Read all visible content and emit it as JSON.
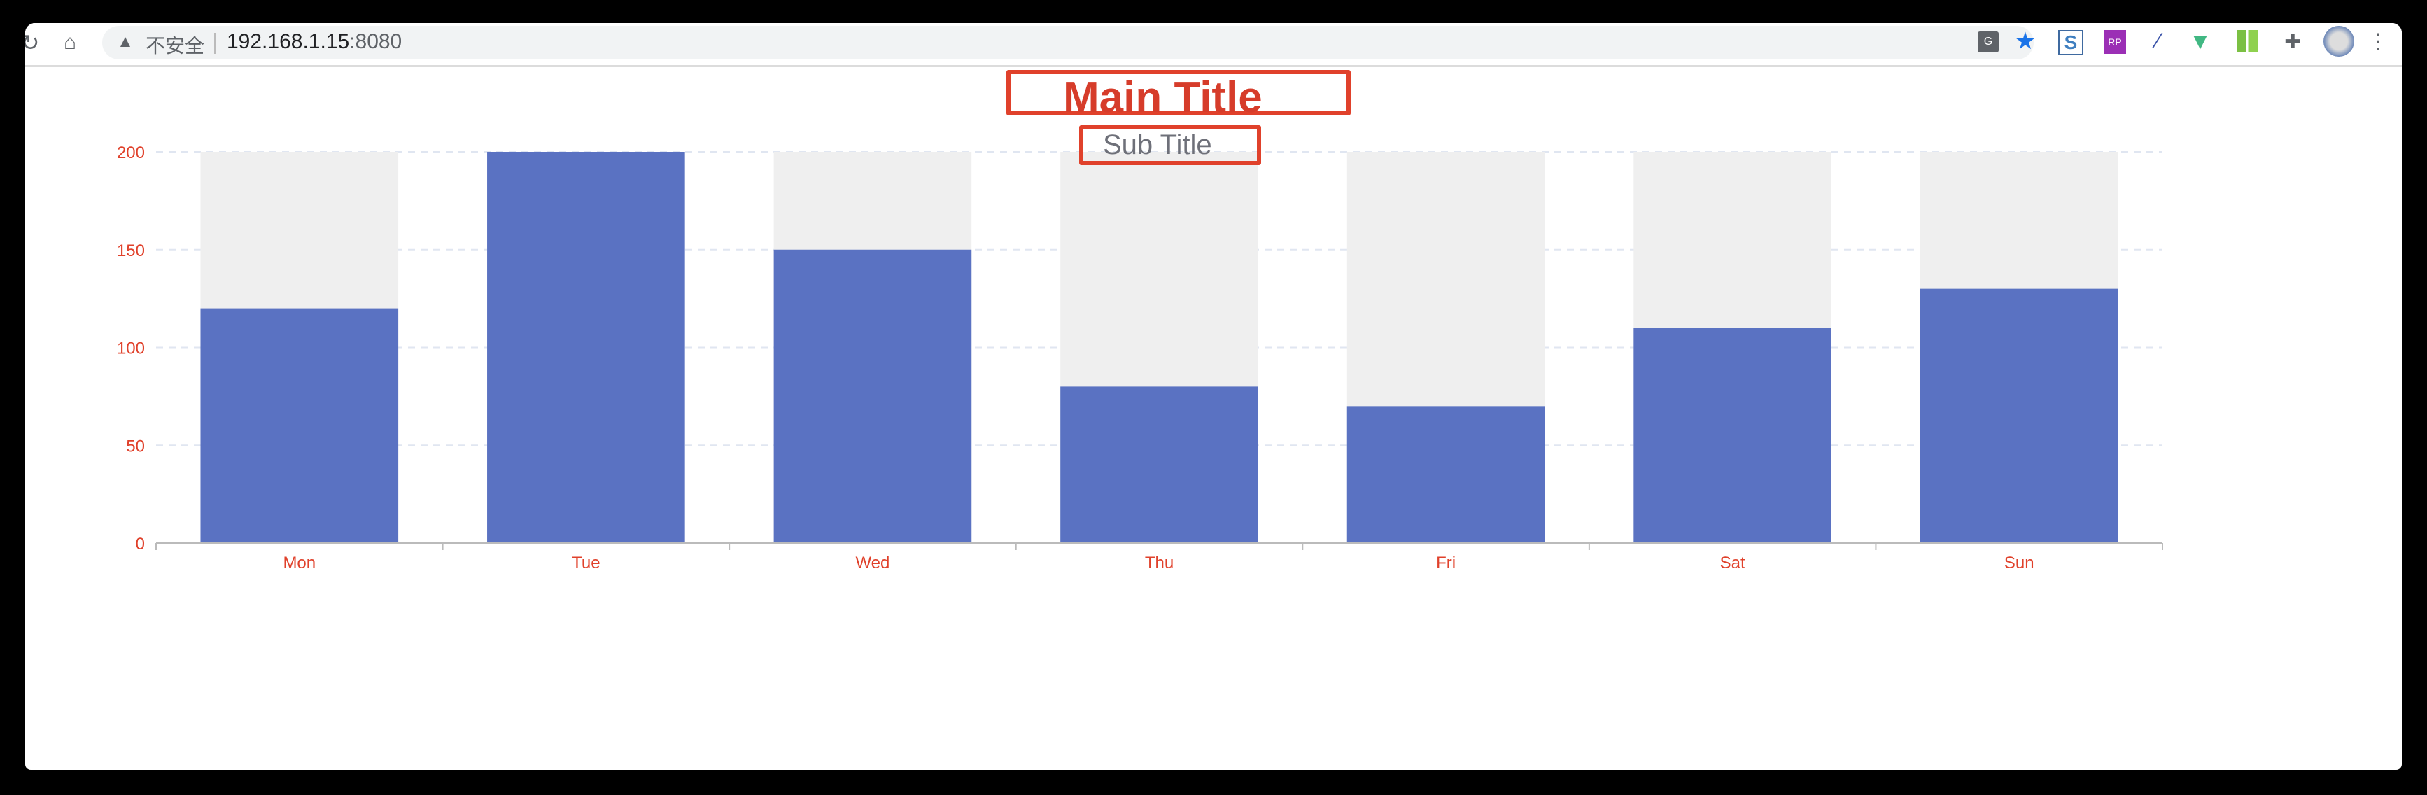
{
  "browser": {
    "security_label": "不安全",
    "url_host": "192.168.1.15",
    "url_port": ":8080",
    "extensions": [
      "translate-icon",
      "bookmark-star-icon",
      "s-extension-icon",
      "axure-rp-icon",
      "eyedropper-icon",
      "vue-devtools-icon",
      "grid-extension-icon",
      "puzzle-extensions-icon",
      "profile-avatar",
      "menu-kebab-icon"
    ]
  },
  "chart_data": {
    "type": "bar",
    "title": "Main Title",
    "subtitle": "Sub Title",
    "categories": [
      "Mon",
      "Tue",
      "Wed",
      "Thu",
      "Fri",
      "Sat",
      "Sun"
    ],
    "values": [
      120,
      200,
      150,
      80,
      70,
      110,
      130
    ],
    "background_bar_max": 200,
    "ylim": [
      0,
      200
    ],
    "yticks": [
      0,
      50,
      100,
      150,
      200
    ],
    "grid": true,
    "colors": {
      "bar": "#5a72c2",
      "background_bar": "#efefef",
      "axis_label": "#e0412b",
      "title": "#d63c2a",
      "subtitle": "#6e7079",
      "title_border": "#e0412b",
      "grid": "#e0e6f1"
    }
  }
}
